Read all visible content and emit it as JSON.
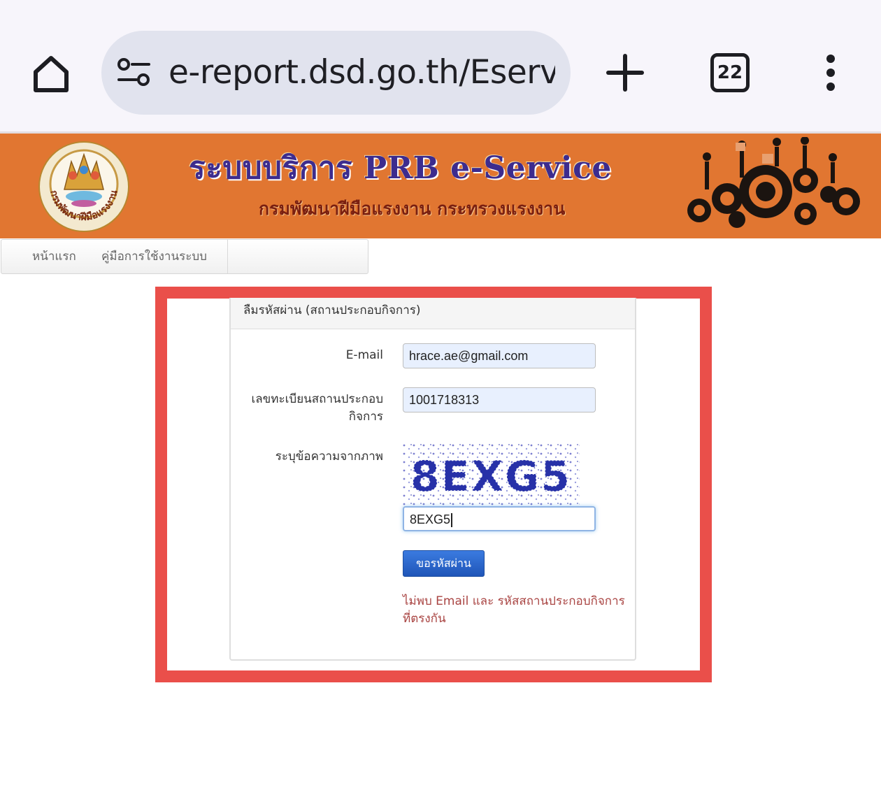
{
  "browser": {
    "url": "e-report.dsd.go.th/Eservic",
    "tab_count": "22",
    "icons": [
      "home-icon",
      "site-settings-icon",
      "plus-icon",
      "tab-switcher-icon",
      "more-vert-icon"
    ]
  },
  "banner": {
    "title": "ระบบบริการ PRB e-Service",
    "subtitle": "กรมพัฒนาฝีมือแรงงาน กระทรวงแรงงาน",
    "seal_text": "กรมพัฒนาฝีมือแรงงาน",
    "background": "#e17631"
  },
  "nav": {
    "items": [
      {
        "label": "หน้าแรก"
      },
      {
        "label": "คู่มือการใช้งานระบบ"
      }
    ]
  },
  "form": {
    "title": "ลืมรหัสผ่าน (สถานประกอบกิจการ)",
    "email_label": "E-mail",
    "email_value": "hrace.ae@gmail.com",
    "reg_label_line1": "เลขทะเบียนสถานประกอบ",
    "reg_label_line2": "กิจการ",
    "reg_value": "1001718313",
    "captcha_label": "ระบุข้อความจากภาพ",
    "captcha_image_text": "8EXG5",
    "captcha_value": "8EXG5",
    "submit_label": "ขอรหัสผ่าน",
    "error_message": "ไม่พบ Email และ รหัสสถานประกอบกิจการที่ตรงกัน",
    "error_color": "#a94442",
    "button_color": "#2a63c8"
  },
  "highlight": {
    "color": "#ea4f4a"
  }
}
